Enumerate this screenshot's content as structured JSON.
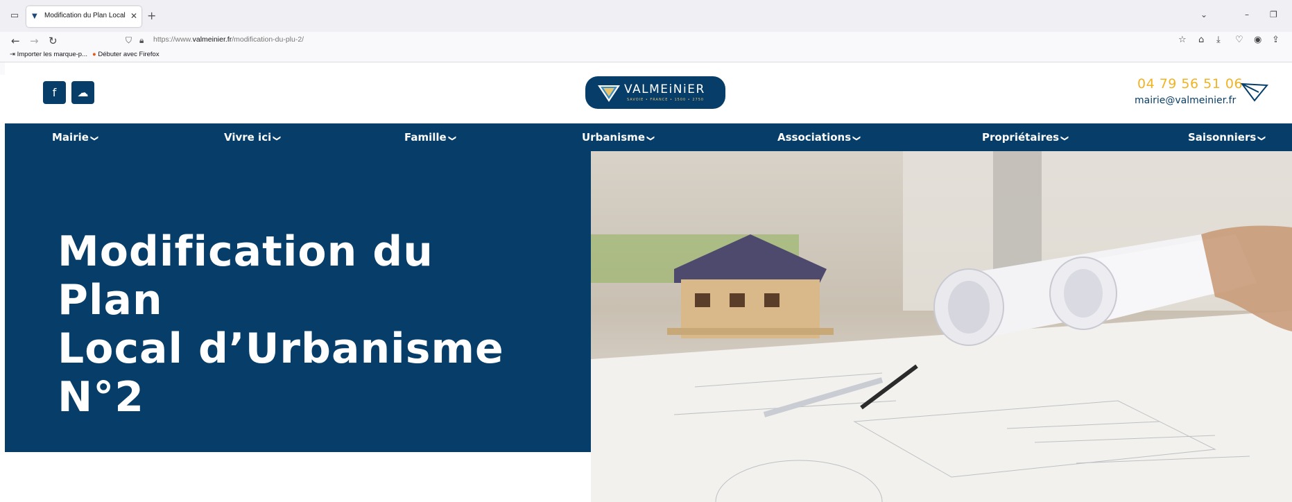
{
  "browser": {
    "tab_title": "Modification du Plan Local d'Urbanisme",
    "url_prefix": "https://www.",
    "url_domain": "valmeinier.fr",
    "url_path": "/modification-du-plu-2/",
    "bookmarks": [
      "Importer les marque-p...",
      "Débuter avec Firefox"
    ]
  },
  "header": {
    "logo_text": "VALMEiNiER",
    "logo_tagline": "SAVOIE • FRANCE • 1500 • 2750",
    "phone": "04 79 56 51 06",
    "email": "mairie@valmeinier.fr"
  },
  "nav": {
    "items": [
      "Mairie",
      "Vivre ici",
      "Famille",
      "Urbanisme",
      "Associations",
      "Propriétaires",
      "Saisonniers"
    ]
  },
  "hero": {
    "title_line1": "Modification du Plan",
    "title_line2": "Local d’Urbanisme",
    "title_line3": "N°2"
  },
  "colors": {
    "brand_blue": "#063e69",
    "accent_gold": "#f0b323"
  }
}
